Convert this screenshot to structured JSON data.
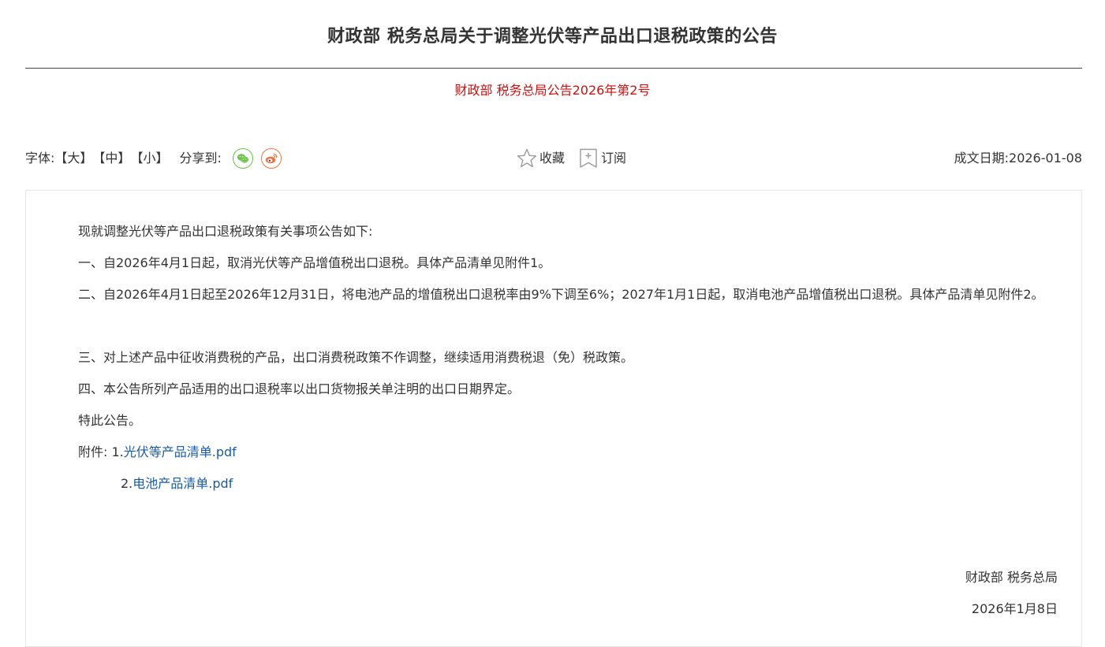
{
  "title": "财政部 税务总局关于调整光伏等产品出口退税政策的公告",
  "doc_number": "财政部 税务总局公告2026年第2号",
  "toolbar": {
    "font_label": "字体:",
    "size_large": "【大】",
    "size_medium": "【中】",
    "size_small": "【小】",
    "share_label": "分享到:",
    "share_icons": [
      "wechat-icon",
      "weibo-icon"
    ],
    "favorite_label": "收藏",
    "subscribe_label": "订阅",
    "date_label": "成文日期:",
    "date_value": "2026-01-08"
  },
  "body": {
    "paragraphs": [
      "现就调整光伏等产品出口退税政策有关事项公告如下:",
      "一、自2026年4月1日起，取消光伏等产品增值税出口退税。具体产品清单见附件1。",
      "二、自2026年4月1日起至2026年12月31日，将电池产品的增值税出口退税率由9%下调至6%；2027年1月1日起，取消电池产品增值税出口退税。具体产品清单见附件2。",
      "三、对上述产品中征收消费税的产品，出口消费税政策不作调整，继续适用消费税退（免）税政策。",
      "四、本公告所列产品适用的出口退税率以出口货物报关单注明的出口日期界定。",
      "特此公告。"
    ],
    "attachments_label": "附件:",
    "attachments": [
      {
        "index": "1.",
        "name": "光伏等产品清单.pdf"
      },
      {
        "index": "2.",
        "name": "电池产品清单.pdf"
      }
    ],
    "signature": "财政部 税务总局",
    "sign_date": "2026年1月8日"
  },
  "colors": {
    "doc_number": "#cc1111",
    "link": "#1a5aa0",
    "wechat": "#6cc24a",
    "weibo": "#e8774b",
    "text": "#333333"
  }
}
